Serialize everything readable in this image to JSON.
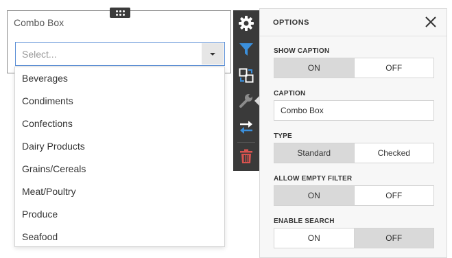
{
  "widget": {
    "caption": "Combo Box",
    "combo": {
      "placeholder": "Select..."
    },
    "dropdown_items": [
      "Beverages",
      "Condiments",
      "Confections",
      "Dairy Products",
      "Grains/Cereals",
      "Meat/Poultry",
      "Produce",
      "Seafood"
    ]
  },
  "toolbar": {
    "icons": [
      "gear-icon",
      "filter-icon",
      "convert-icon",
      "wrench-icon",
      "interchange-icon",
      "trash-icon"
    ],
    "colors": {
      "background": "#3a3a3a",
      "accent_blue": "#3b8fdb",
      "delete_red": "#d9534f",
      "inactive": "#8c8c8c"
    }
  },
  "options": {
    "title": "OPTIONS",
    "show_caption": {
      "label": "SHOW CAPTION",
      "on": "ON",
      "off": "OFF",
      "selected": "on"
    },
    "caption": {
      "label": "CAPTION",
      "value": "Combo Box"
    },
    "type": {
      "label": "TYPE",
      "standard": "Standard",
      "checked": "Checked",
      "selected": "standard"
    },
    "allow_empty_filter": {
      "label": "ALLOW EMPTY FILTER",
      "on": "ON",
      "off": "OFF",
      "selected": "on"
    },
    "enable_search": {
      "label": "ENABLE SEARCH",
      "on": "ON",
      "off": "OFF",
      "selected": "off"
    }
  }
}
